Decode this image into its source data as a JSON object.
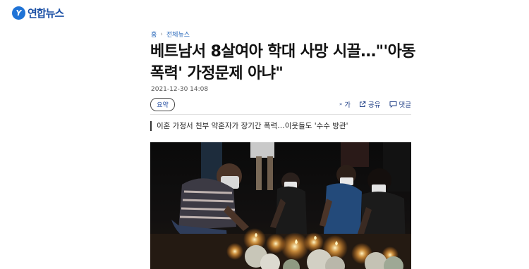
{
  "site": {
    "logo_mark": "Y",
    "logo_text": "연합뉴스"
  },
  "breadcrumb": {
    "home": "홈",
    "section": "전체뉴스"
  },
  "article": {
    "title": "베트남서 8살여아 학대 사망 시끌…\"'아동 폭력' 가정문제 아냐\"",
    "date": "2021-12-30 14:08",
    "summary_label": "요약",
    "subtitle": "이혼 가정서 친부 약혼자가 장기간 폭력…이웃들도 '수수 방관'"
  },
  "tools": {
    "font_label": "가",
    "share_label": "공유",
    "comment_label": "댓글"
  },
  "colors": {
    "accent": "#1f62b8",
    "logo": "#1a4fa5"
  },
  "photo": {
    "description_icon": "candlelight-vigil-photo"
  }
}
